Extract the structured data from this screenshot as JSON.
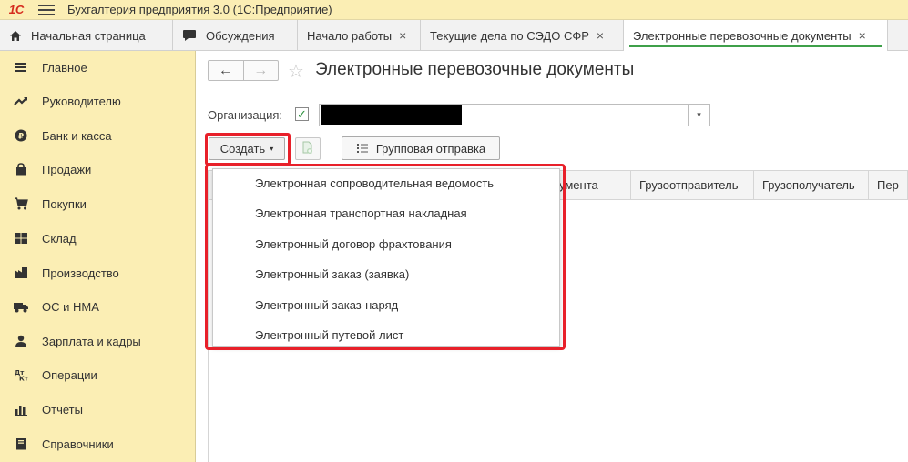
{
  "app": {
    "logo": "1С",
    "title": "Бухгалтерия предприятия 3.0  (1С:Предприятие)"
  },
  "tabs": [
    {
      "label": "Начальная страница",
      "icon": "home-icon",
      "closable": false
    },
    {
      "label": "Обсуждения",
      "icon": "chat-icon",
      "closable": false
    },
    {
      "label": "Начало работы",
      "closable": true
    },
    {
      "label": "Текущие дела по СЭДО СФР",
      "closable": true
    },
    {
      "label": "Электронные перевозочные документы",
      "closable": true,
      "active": true
    }
  ],
  "close_glyph": "×",
  "sidebar": {
    "items": [
      {
        "label": "Главное",
        "icon": "menu-lines-icon"
      },
      {
        "label": "Руководителю",
        "icon": "trend-up-icon"
      },
      {
        "label": "Банк и касса",
        "icon": "ruble-coin-icon"
      },
      {
        "label": "Продажи",
        "icon": "shopping-bag-icon"
      },
      {
        "label": "Покупки",
        "icon": "cart-icon"
      },
      {
        "label": "Склад",
        "icon": "warehouse-icon"
      },
      {
        "label": "Производство",
        "icon": "factory-icon"
      },
      {
        "label": "ОС и НМА",
        "icon": "truck-icon"
      },
      {
        "label": "Зарплата и кадры",
        "icon": "person-icon"
      },
      {
        "label": "Операции",
        "icon": "dt-kt-icon"
      },
      {
        "label": "Отчеты",
        "icon": "bar-chart-icon"
      },
      {
        "label": "Справочники",
        "icon": "book-icon"
      }
    ]
  },
  "page": {
    "title": "Электронные перевозочные документы",
    "nav_back": "←",
    "nav_forward": "→",
    "star": "☆"
  },
  "org": {
    "label": "Организация:",
    "checked": true,
    "check_glyph": "✓",
    "dropdown_glyph": "▾"
  },
  "toolbar": {
    "create_label": "Создать",
    "create_arrow": "▾",
    "group_send_label": "Групповая отправка"
  },
  "table": {
    "columns": [
      "",
      "",
      "",
      "умента",
      "Грузоотправитель",
      "Грузополучатель",
      "Пер"
    ]
  },
  "create_menu": {
    "items": [
      "Электронная сопроводительная ведомость",
      "Электронная транспортная накладная",
      "Электронный договор фрахтования",
      "Электронный заказ (заявка)",
      "Электронный заказ-наряд",
      "Электронный путевой лист"
    ]
  },
  "colors": {
    "sidebar_bg": "#fbeeb4",
    "highlight": "#e8202a",
    "active_tab_underline": "#3fa04a",
    "brand": "#d52b1e"
  }
}
